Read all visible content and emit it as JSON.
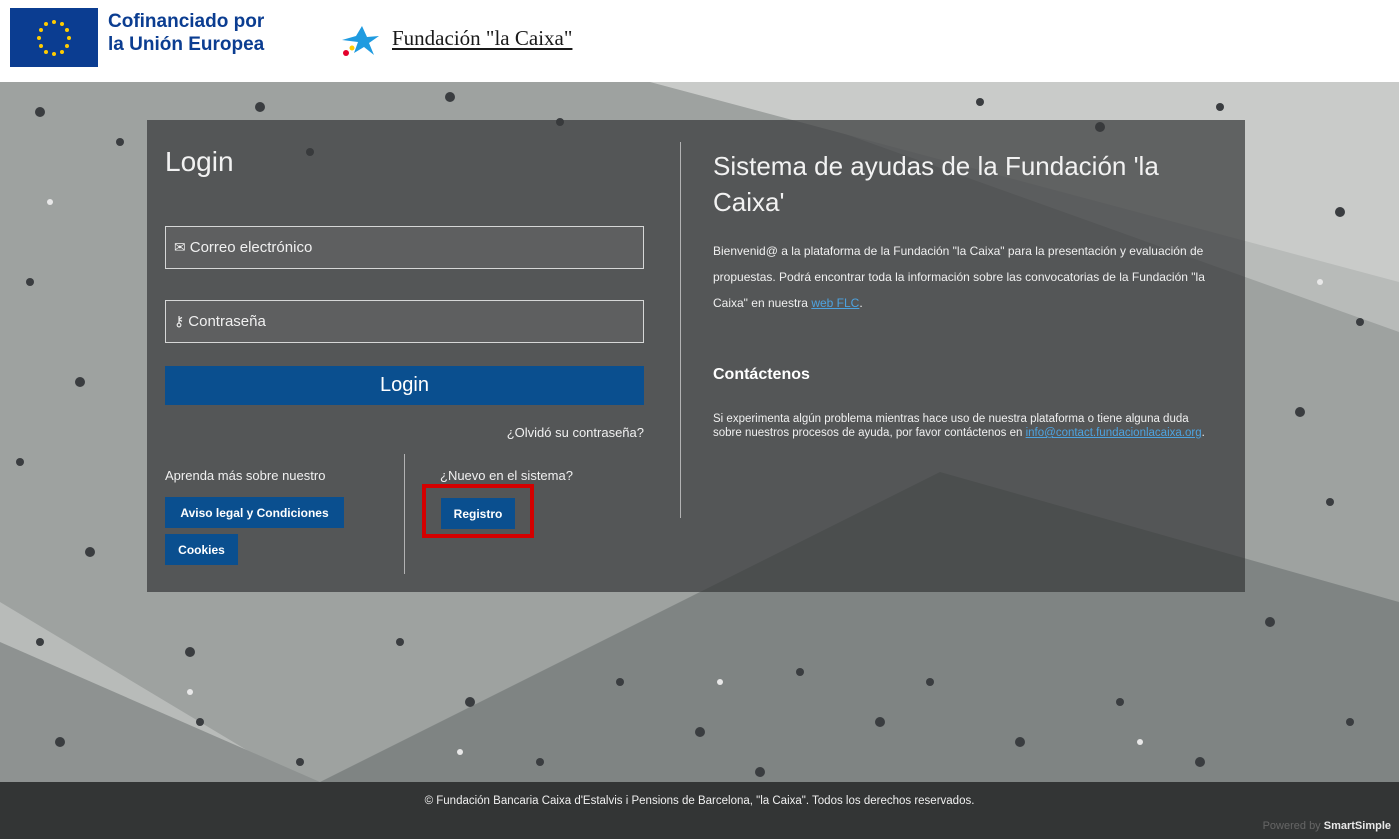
{
  "header": {
    "eu_line1": "Cofinanciado por",
    "eu_line2": "la Unión Europea",
    "caixa_name": "Fundación \"la Caixa\""
  },
  "login": {
    "title": "Login",
    "email_placeholder": "Correo electrónico",
    "password_placeholder": "Contraseña",
    "login_button": "Login",
    "forgot_link": "¿Olvidó su contraseña?",
    "learn_more": "Aprenda más sobre nuestro",
    "aviso_button": "Aviso legal y Condiciones",
    "cookies_button": "Cookies",
    "new_system": "¿Nuevo en el sistema?",
    "registro_button": "Registro"
  },
  "info": {
    "title": "Sistema de ayudas de la Fundación 'la Caixa'",
    "welcome_before": "Bienvenid@ a la plataforma de la Fundación \"la Caixa\" para la presentación y evaluación de propuestas. Podrá encontrar toda la información sobre las convocatorias de la Fundación \"la Caixa\" en nuestra ",
    "welcome_link": "web FLC",
    "welcome_after": ".",
    "contact_title": "Contáctenos",
    "contact_before": "Si experimenta algún problema mientras hace uso de nuestra plataforma o tiene alguna duda sobre nuestros procesos de ayuda, por favor contáctenos en ",
    "contact_email": "info@contact.fundacionlacaixa.org",
    "contact_after": "."
  },
  "footer": {
    "copyright": "© Fundación Bancaria Caixa d'Estalvis i Pensions de Barcelona, \"la Caixa\". Todos los derechos reservados.",
    "powered_prefix": "Powered by",
    "powered_brand": "SmartSimple"
  },
  "colors": {
    "primary_button": "#0a4f8f",
    "highlight": "#d40000",
    "eu_blue": "#0b3d91",
    "link": "#4da3e0"
  },
  "icons": {
    "email": "envelope-icon",
    "password": "key-icon",
    "eu_flag": "eu-flag-icon",
    "caixa_star": "caixa-star-icon"
  }
}
